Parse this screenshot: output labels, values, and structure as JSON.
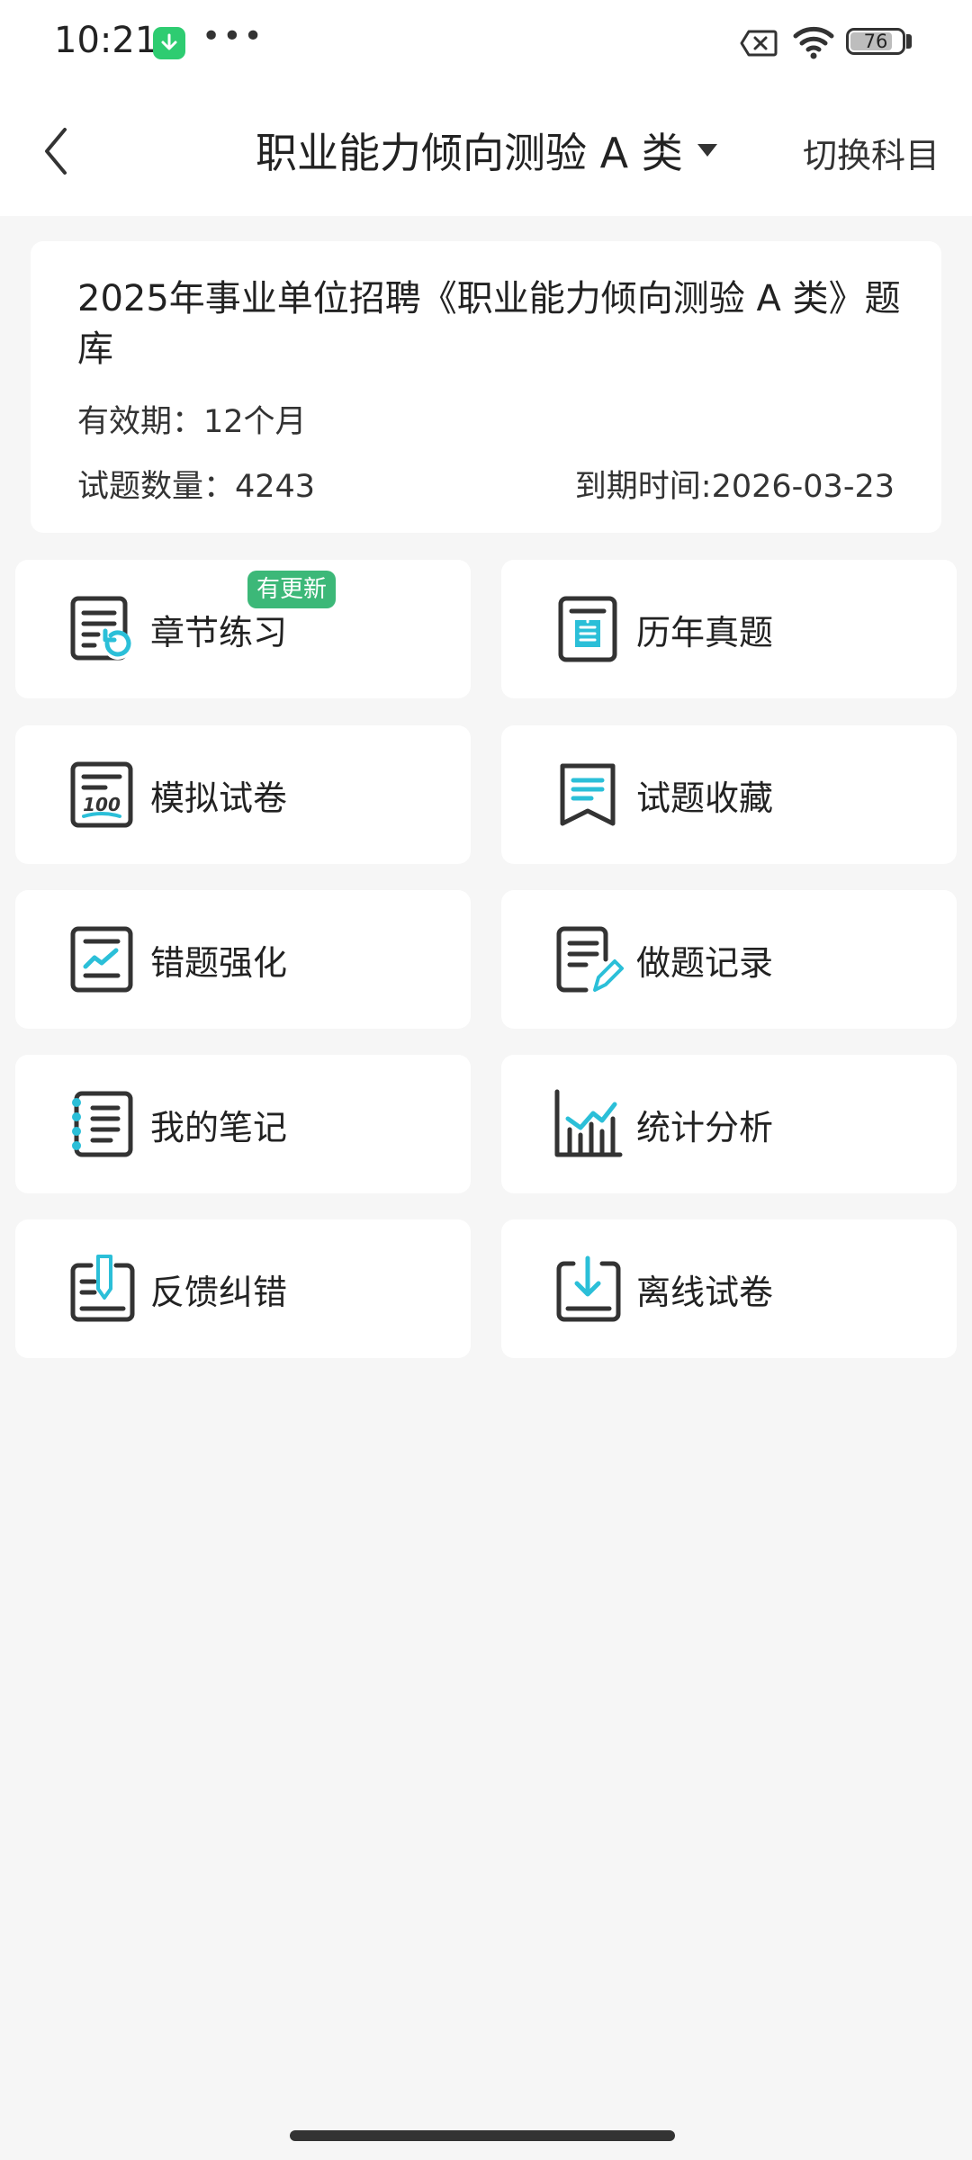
{
  "status_bar": {
    "time": "10:21",
    "battery": "76",
    "battery_level": 0.76,
    "icons": [
      "download-icon",
      "more-dots-icon",
      "sim-off-icon",
      "wifi-icon",
      "battery-icon"
    ]
  },
  "nav": {
    "title": "职业能力倾向测验 A 类",
    "switch_label": "切换科目"
  },
  "info": {
    "title": "2025年事业单位招聘《职业能力倾向测验 A 类》题库",
    "validity": "有效期：12个月",
    "count": "试题数量：4243",
    "expiry": "到期时间:2026-03-23"
  },
  "menu": {
    "items": [
      {
        "label": "章节练习",
        "icon": "chapter-practice-icon",
        "badge": "有更新"
      },
      {
        "label": "历年真题",
        "icon": "past-papers-icon"
      },
      {
        "label": "模拟试卷",
        "icon": "mock-exam-icon"
      },
      {
        "label": "试题收藏",
        "icon": "bookmark-icon"
      },
      {
        "label": "错题强化",
        "icon": "wrong-question-icon"
      },
      {
        "label": "做题记录",
        "icon": "record-icon"
      },
      {
        "label": "我的笔记",
        "icon": "notebook-icon"
      },
      {
        "label": "统计分析",
        "icon": "statistics-icon"
      },
      {
        "label": "反馈纠错",
        "icon": "feedback-icon"
      },
      {
        "label": "离线试卷",
        "icon": "offline-download-icon"
      }
    ]
  },
  "colors": {
    "accent": "#2bbfd8",
    "badge": "#3cb878",
    "icon_stroke": "#333333",
    "background": "#f6f6f6"
  }
}
